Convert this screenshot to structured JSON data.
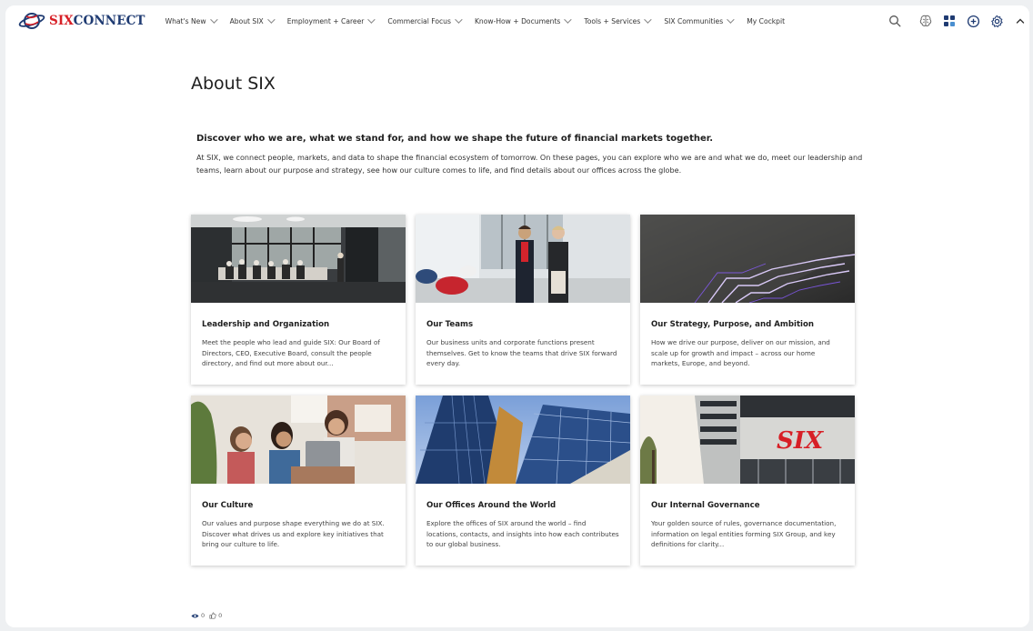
{
  "brand": {
    "logo_six": "SIX",
    "logo_connect": "CONNECT",
    "accent_red": "#d71f26",
    "accent_navy": "#1f3b72"
  },
  "nav": {
    "items": [
      {
        "label": "What's New"
      },
      {
        "label": "About SIX"
      },
      {
        "label": "Employment + Career"
      },
      {
        "label": "Commercial Focus"
      },
      {
        "label": "Know-How + Documents"
      },
      {
        "label": "Tools + Services"
      },
      {
        "label": "SIX Communities"
      },
      {
        "label": "My Cockpit"
      }
    ],
    "tools": [
      "search-icon",
      "brain-icon",
      "apps-grid-icon",
      "add-circle-icon",
      "gear-icon",
      "chevron-up-icon"
    ]
  },
  "main": {
    "title": "About SIX",
    "intro_heading": "Discover who we are, what we stand for, and how we shape the future of financial markets together.",
    "intro_text": "At SIX, we connect people, markets, and data to shape the financial ecosystem of tomorrow. On these pages, you can explore who we are and what we do, meet our leadership and teams, learn about our purpose and strategy, see how our culture comes to life, and find details about our offices across the globe."
  },
  "cards": [
    {
      "title": "Leadership and Organization",
      "description": "Meet the people who lead and guide SIX: Our Board of Directors, CEO, Executive Board, consult the people directory, and find out more about our..."
    },
    {
      "title": "Our Teams",
      "description": "Our business units and corporate functions present themselves. Get to know the teams that drive SIX forward every day."
    },
    {
      "title": "Our Strategy, Purpose, and Ambition",
      "description": "How we drive our purpose, deliver on our mission, and scale up for growth and impact – across our home markets, Europe, and beyond."
    },
    {
      "title": "Our Culture",
      "description": "Our values and purpose shape everything we do at SIX. Discover what drives us and explore key initiatives that bring our culture to life."
    },
    {
      "title": "Our Offices Around the World",
      "description": "Explore the offices of SIX around the world – find locations, contacts, and insights into how each contributes to our global business."
    },
    {
      "title": "Our Internal Governance",
      "description": "Your golden source of rules, governance documentation, information on legal entities forming SIX Group, and key definitions for clarity..."
    }
  ],
  "reactions": {
    "views": "0",
    "likes": "0"
  }
}
